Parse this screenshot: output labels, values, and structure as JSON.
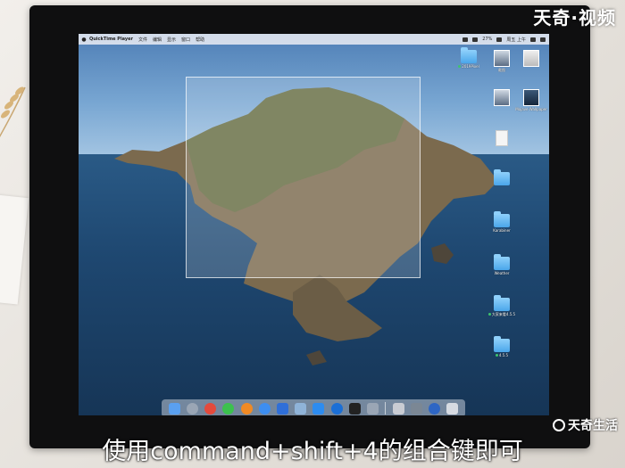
{
  "menubar": {
    "app_name": "QuickTime Player",
    "items": [
      "文件",
      "编辑",
      "显示",
      "窗口",
      "帮助"
    ],
    "battery": "27%",
    "clock": "周五 上午"
  },
  "desktop_icons": [
    {
      "type": "folder",
      "label": "2019Pixel"
    },
    {
      "type": "thumb",
      "label": "截图"
    },
    {
      "type": "thumb",
      "label": ""
    },
    {
      "type": "thumb",
      "label": ""
    },
    {
      "type": "thumb",
      "label": "Mojave Wallpaper"
    },
    {
      "type": "doc",
      "label": ""
    },
    {
      "type": "folder",
      "label": ""
    },
    {
      "type": "folder",
      "label": "Karabiner"
    },
    {
      "type": "folder",
      "label": "Weather"
    },
    {
      "type": "folder",
      "label": "大家来看4.5.5"
    },
    {
      "type": "folder",
      "label": "4.5.5"
    }
  ],
  "watermark": "天奇·视频",
  "brand": "天奇生活",
  "subtitle": "使用command+shift+4的组合键即可"
}
